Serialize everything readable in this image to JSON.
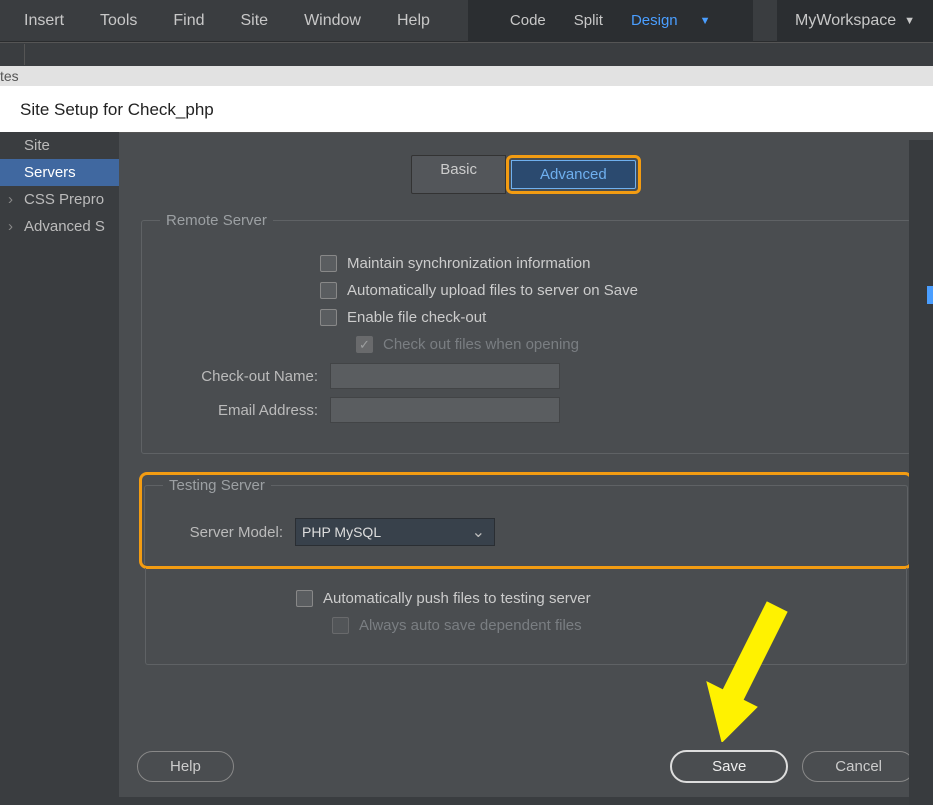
{
  "menubar": {
    "items": [
      "Insert",
      "Tools",
      "Find",
      "Site",
      "Window",
      "Help"
    ],
    "views": {
      "code": "Code",
      "split": "Split",
      "design": "Design"
    },
    "workspace": "MyWorkspace"
  },
  "secondary_tabs": {
    "truncated": "tes"
  },
  "dialog": {
    "title": "Site Setup for Check_php",
    "sidebar": [
      "Site",
      "Servers",
      "CSS Prepro",
      "Advanced S"
    ],
    "tabs": {
      "basic": "Basic",
      "advanced": "Advanced"
    },
    "remote_server": {
      "legend": "Remote Server",
      "maintain_sync": "Maintain synchronization information",
      "auto_upload": "Automatically upload files to server on Save",
      "enable_checkout": "Enable file check-out",
      "check_out_opening": "Check out files when opening",
      "checkout_name_label": "Check-out Name:",
      "checkout_name_value": "",
      "email_label": "Email Address:",
      "email_value": ""
    },
    "testing_server": {
      "legend": "Testing Server",
      "server_model_label": "Server Model:",
      "server_model_value": "PHP MySQL",
      "auto_push": "Automatically push files to testing server",
      "auto_save_dep": "Always auto save dependent files"
    },
    "buttons": {
      "help": "Help",
      "save": "Save",
      "cancel": "Cancel"
    }
  },
  "colors": {
    "highlight": "#f39c12",
    "arrow": "#fff200",
    "active_blue": "#4a9eff"
  }
}
